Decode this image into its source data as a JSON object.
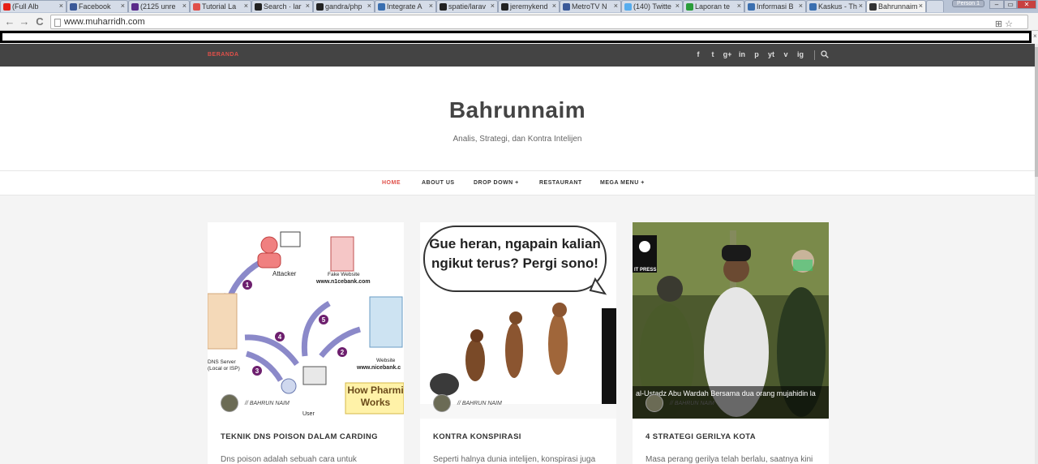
{
  "browser": {
    "tabs": [
      {
        "label": "(Full Alb",
        "color": "#e62117"
      },
      {
        "label": "Facebook",
        "color": "#3b5998"
      },
      {
        "label": "(2125 unre",
        "color": "#5b2b8a"
      },
      {
        "label": "Tutorial La",
        "color": "#e0504a"
      },
      {
        "label": "Search · lar",
        "color": "#222222"
      },
      {
        "label": "gandra/php",
        "color": "#222222"
      },
      {
        "label": "Integrate A",
        "color": "#3a6fb0"
      },
      {
        "label": "spatie/larav",
        "color": "#222222"
      },
      {
        "label": "jeremykend",
        "color": "#222222"
      },
      {
        "label": "MetroTV N",
        "color": "#3b5998"
      },
      {
        "label": "(140) Twitte",
        "color": "#55acee"
      },
      {
        "label": "Laporan te",
        "color": "#2a9d3a"
      },
      {
        "label": "Informasi B",
        "color": "#3a6fb0"
      },
      {
        "label": "Kaskus - Th",
        "color": "#3a6fb0"
      },
      {
        "label": "Bahrunnaim",
        "color": "#333333"
      }
    ],
    "person_label": "Person 1",
    "url": "www.muharridh.com",
    "window_controls": {
      "minimize": "–",
      "maximize": "▭",
      "close": "✕"
    },
    "nav_icons": {
      "back": "←",
      "forward": "→",
      "reload": "C"
    },
    "extension_icons": "⊞ ☆",
    "side_close": "×"
  },
  "topbar": {
    "beranda": "BERANDA",
    "social_icons": [
      "f",
      "t",
      "g+",
      "in",
      "p",
      "yt",
      "v",
      "ig"
    ]
  },
  "site": {
    "title": "Bahrunnaim",
    "tagline": "Analis, Strategi, dan Kontra Intelijen"
  },
  "menu": {
    "items": [
      "HOME",
      "ABOUT US",
      "DROP DOWN +",
      "RESTAURANT",
      "MEGA MENU +"
    ]
  },
  "posts": [
    {
      "author": "// BAHRUN NAIM",
      "title": "TEKNIK DNS POISON DALAM CARDING",
      "excerpt": "Dns poison adalah sebuah cara untuk",
      "image": {
        "attacker": "Attacker",
        "fake_website": "Fake Website",
        "fake_url": "www.n1cebank.com",
        "dns_server": "DNS Server",
        "dns_sub": "(Local or ISP)",
        "website": "Website",
        "real_url": "www.nicebank.c",
        "user": "User",
        "pharming": "How Pharmi Works",
        "steps": [
          "1",
          "2",
          "3",
          "4",
          "5"
        ]
      }
    },
    {
      "author": "// BAHRUN NAIM",
      "title": "KONTRA KONSPIRASI",
      "excerpt": "Seperti halnya dunia intelijen, konspirasi juga",
      "image": {
        "speech": "Gue heran, ngapain kalian ngikut terus? Pergi sono!"
      }
    },
    {
      "author": "// BAHRUN NAIM",
      "title": "4 STRATEGI GERILYA KOTA",
      "excerpt": "Masa perang gerilya telah berlalu, saatnya kini",
      "image": {
        "press": "IT PRESS",
        "caption": "al-Ustadz Abu Wardah Bersama dua orang mujahidin la"
      }
    }
  ],
  "colors": {
    "accent": "#e0504a",
    "topbar": "#444444",
    "background": "#f4f4f4"
  }
}
